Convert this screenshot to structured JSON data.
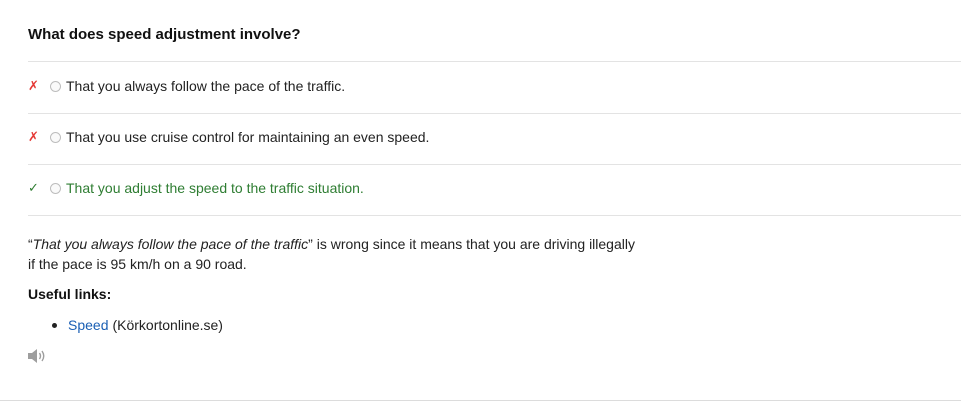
{
  "question": "What does speed adjustment involve?",
  "answers": [
    {
      "mark": "✗",
      "text": "That you always follow the pace of the traffic.",
      "correct": false
    },
    {
      "mark": "✗",
      "text": "That you use cruise control for maintaining an even speed.",
      "correct": false
    },
    {
      "mark": "✓",
      "text": "That you adjust the speed to the traffic situation.",
      "correct": true
    }
  ],
  "explanation": {
    "quote": "That you always follow the pace of the traffic",
    "open_quote": "“",
    "close_quote": "”",
    "rest": " is wrong since it means that you are driving illegally if the pace is 95 km/h on a 90 road."
  },
  "links": {
    "title": "Useful links:",
    "items": [
      {
        "label": "Speed",
        "source": "(Körkortonline.se)"
      }
    ]
  },
  "icons": {
    "wrong": "cross-icon",
    "right": "check-icon",
    "audio": "speaker-icon"
  },
  "colors": {
    "wrong": "#e53935",
    "correct": "#2e7d32",
    "link": "#1a5fb4"
  }
}
